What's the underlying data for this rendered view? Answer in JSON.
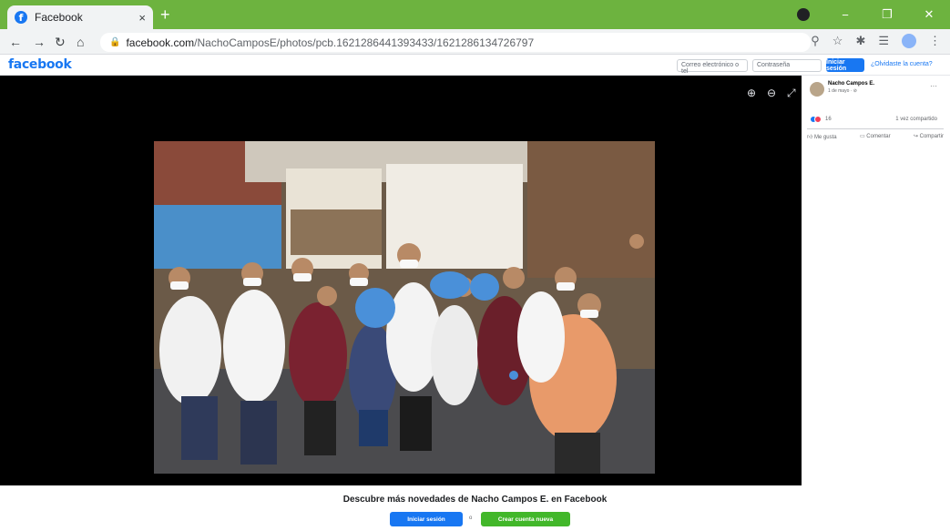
{
  "browser": {
    "tab_title": "Facebook",
    "tab_close": "×",
    "new_tab": "+",
    "url_host": "facebook.com",
    "url_path": "/NachoCamposE/photos/pcb.1621286441393433/1621286134726797"
  },
  "header": {
    "logo": "facebook",
    "email_placeholder": "Correo electrónico o tel",
    "password_placeholder": "Contraseña",
    "login_label": "Iniciar sesión",
    "forgot_label": "¿Olvidaste la cuenta?"
  },
  "post": {
    "author": "Nacho Campos E.",
    "date": "1 de mayo · ⊘",
    "more": "···",
    "reaction_count": "16",
    "shares": "1 vez compartido",
    "actions": {
      "like": "Me gusta",
      "comment": "Comentar",
      "share": "Compartir"
    }
  },
  "banner": {
    "title": "Descubre más novedades de Nacho Campos E. en Facebook",
    "login_label": "Iniciar sesión",
    "or": "o",
    "signup_label": "Crear cuenta nueva"
  },
  "colors": {
    "titlebar": "#6db33f",
    "fb_blue": "#1877f2",
    "signup_green": "#42b72a"
  }
}
